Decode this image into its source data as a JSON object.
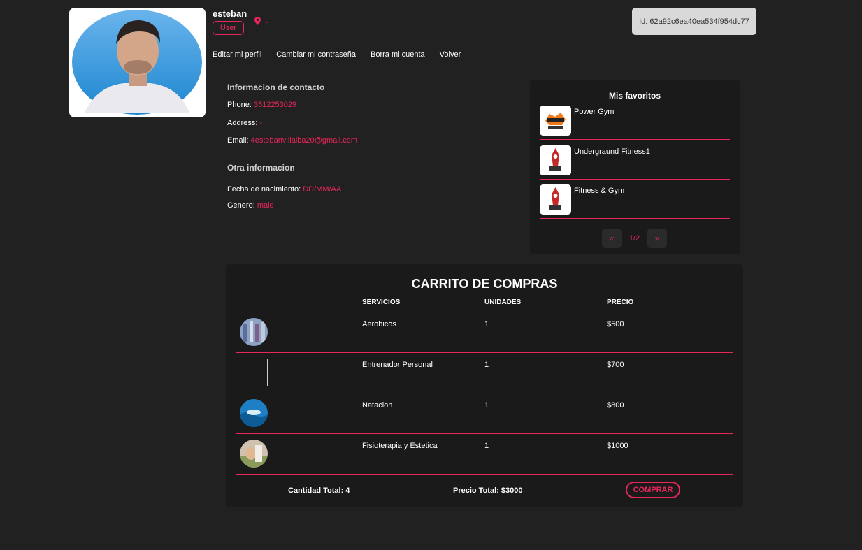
{
  "profile": {
    "username": "esteban",
    "role": "User",
    "location": "-",
    "id_label": "Id: 62a92c6ea40ea534f954dc77"
  },
  "nav": {
    "items": [
      {
        "label": "Editar mi perfil"
      },
      {
        "label": "Cambiar mi contraseña"
      },
      {
        "label": "Borra mi cuenta"
      },
      {
        "label": "Volver"
      }
    ]
  },
  "contact": {
    "title": "Informacion de contacto",
    "phone_label": "Phone:",
    "phone": "3512253029",
    "address_label": "Address:",
    "address": "-",
    "email_label": "Email:",
    "email": "4estebanvillalba20@gmail.com"
  },
  "other": {
    "title": "Otra informacion",
    "birth_label": "Fecha de nacimiento:",
    "birth": "DD/MM/AA",
    "gender_label": "Genero:",
    "gender": "male"
  },
  "favorites": {
    "title": "Mis favoritos",
    "items": [
      {
        "name": "Power Gym"
      },
      {
        "name": "Undergraund Fitness1"
      },
      {
        "name": "Fitness & Gym"
      }
    ],
    "prev": "«",
    "page": "1/2",
    "next": "»"
  },
  "cart": {
    "title": "CARRITO DE COMPRAS",
    "headers": {
      "servicios": "SERVICIOS",
      "unidades": "UNIDADES",
      "precio": "PRECIO"
    },
    "rows": [
      {
        "servicio": "Aerobicos",
        "unidades": "1",
        "precio": "$500"
      },
      {
        "servicio": "Entrenador Personal",
        "unidades": "1",
        "precio": "$700"
      },
      {
        "servicio": "Natacion",
        "unidades": "1",
        "precio": "$800"
      },
      {
        "servicio": "Fisioterapia y Estetica",
        "unidades": "1",
        "precio": "$1000"
      }
    ],
    "total_qty": "Cantidad Total: 4",
    "total_price": "Precio Total: $3000",
    "buy": "COMPRAR"
  },
  "colors": {
    "background": "#212121",
    "panel": "#1a1a1a",
    "accent": "#e8265a"
  }
}
